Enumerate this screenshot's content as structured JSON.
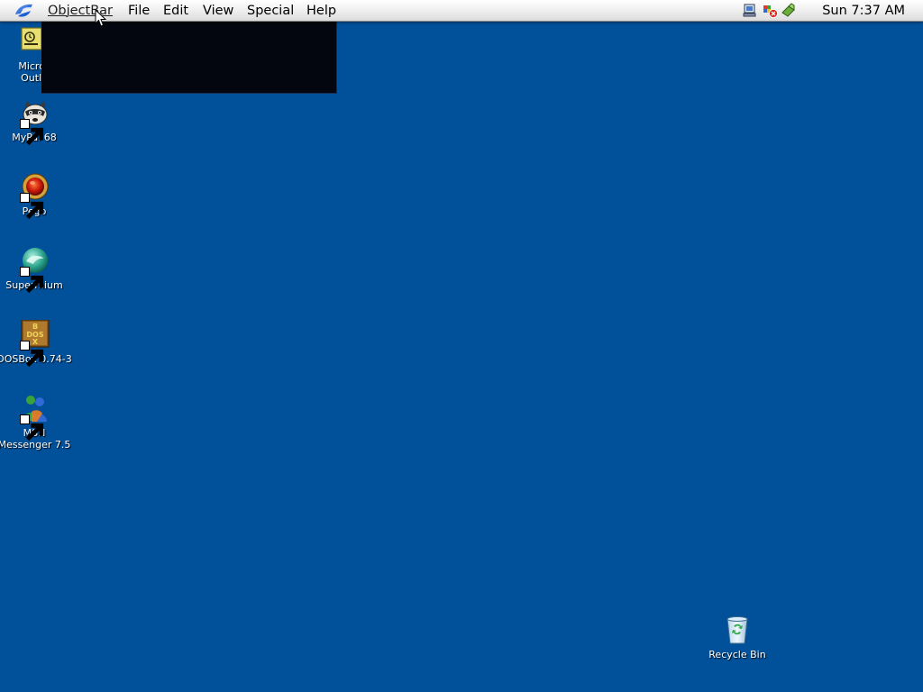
{
  "menubar": {
    "apple_icon": "apple-menu-icon",
    "app_name": "ObjectBar",
    "menus": [
      "File",
      "Edit",
      "View",
      "Special",
      "Help"
    ],
    "tray_icons": [
      "network-icon",
      "security-alert-icon",
      "hardware-icon"
    ],
    "clock": "Sun 7:37 AM"
  },
  "desktop": {
    "icons": [
      {
        "name": "outlook",
        "label": "Micros\nOutlo",
        "icon": "outlook-icon"
      },
      {
        "name": "mypal",
        "label": "MyPal 68",
        "icon": "raccoon-icon"
      },
      {
        "name": "pego",
        "label": "Pego",
        "icon": "red-orb-icon"
      },
      {
        "name": "supermium",
        "label": "Supermium",
        "icon": "supermium-icon"
      },
      {
        "name": "dosbox",
        "label": "DOSBox 0.74-3",
        "icon": "dosbox-icon"
      },
      {
        "name": "msn",
        "label": "MSN\nMessenger 7.5",
        "icon": "msn-icon"
      },
      {
        "name": "recycle",
        "label": "Recycle Bin",
        "icon": "recycle-bin-icon"
      }
    ]
  },
  "colors": {
    "desktop_bg": "#00509a",
    "menubar_bg": "#f1f1f1",
    "black_window": "#03060f"
  }
}
